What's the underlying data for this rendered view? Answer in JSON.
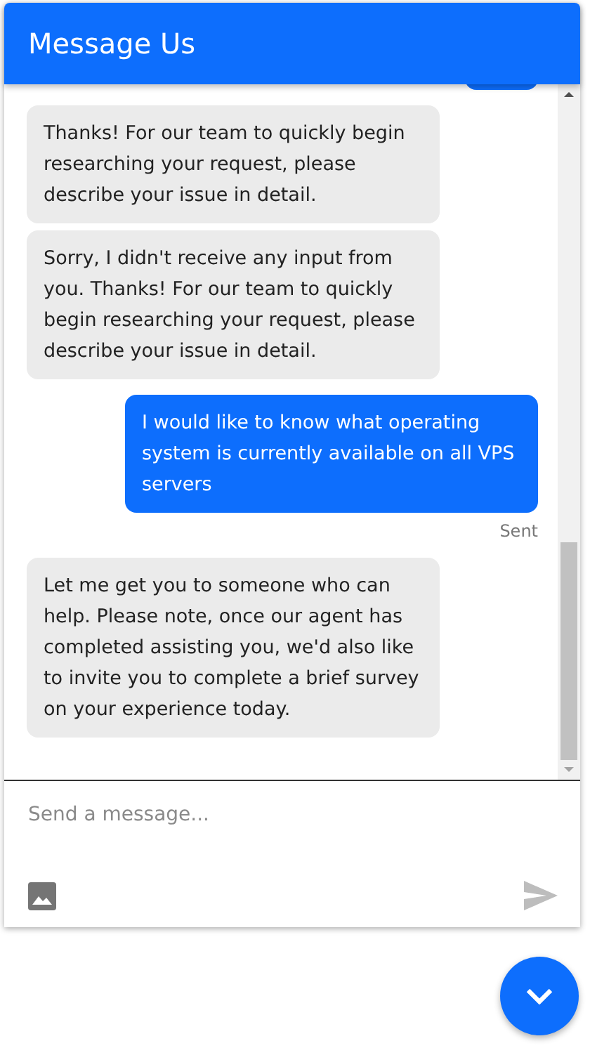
{
  "header": {
    "title": "Message Us"
  },
  "messages": [
    {
      "kind": "agent",
      "text": "Thanks! For our team to quickly begin researching your request, please describe your issue in detail."
    },
    {
      "kind": "agent",
      "text": "Sorry, I didn't receive any input from you. Thanks! For our team to quickly begin researching your request, please describe your issue in detail."
    },
    {
      "kind": "user",
      "text": "I would like to know what operating system is currently available on all VPS servers",
      "status": "Sent"
    },
    {
      "kind": "agent",
      "text": "Let me get you to someone who can help. Please note, once our agent has completed assisting you, we'd also like to invite you to complete a brief survey on your experience today."
    }
  ],
  "composer": {
    "placeholder": "Send a message..."
  }
}
